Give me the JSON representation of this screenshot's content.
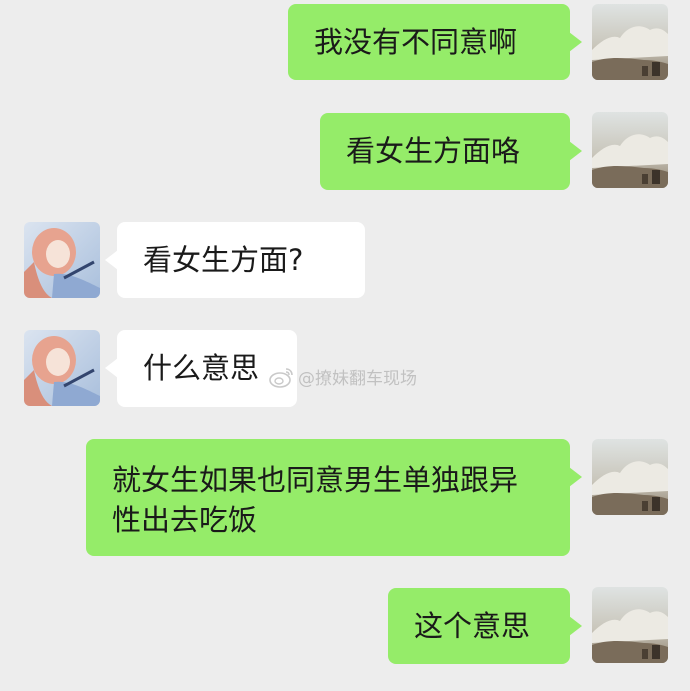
{
  "messages": [
    {
      "side": "me",
      "text": "我没有不同意啊",
      "avatar": "sky-cloud-avatar"
    },
    {
      "side": "me",
      "text": "看女生方面咯",
      "avatar": "sky-cloud-avatar"
    },
    {
      "side": "other",
      "text": "看女生方面?",
      "avatar": "anime-girl-avatar"
    },
    {
      "side": "other",
      "text": "什么意思",
      "avatar": "anime-girl-avatar"
    },
    {
      "side": "me",
      "text": "就女生如果也同意男生单独跟异性出去吃饭",
      "avatar": "sky-cloud-avatar"
    },
    {
      "side": "me",
      "text": "这个意思",
      "avatar": "sky-cloud-avatar"
    }
  ],
  "watermark": {
    "icon": "weibo-icon",
    "text": "@撩妹翻车现场"
  },
  "colors": {
    "background": "#ededed",
    "my_bubble": "#95ec69",
    "other_bubble": "#ffffff"
  }
}
